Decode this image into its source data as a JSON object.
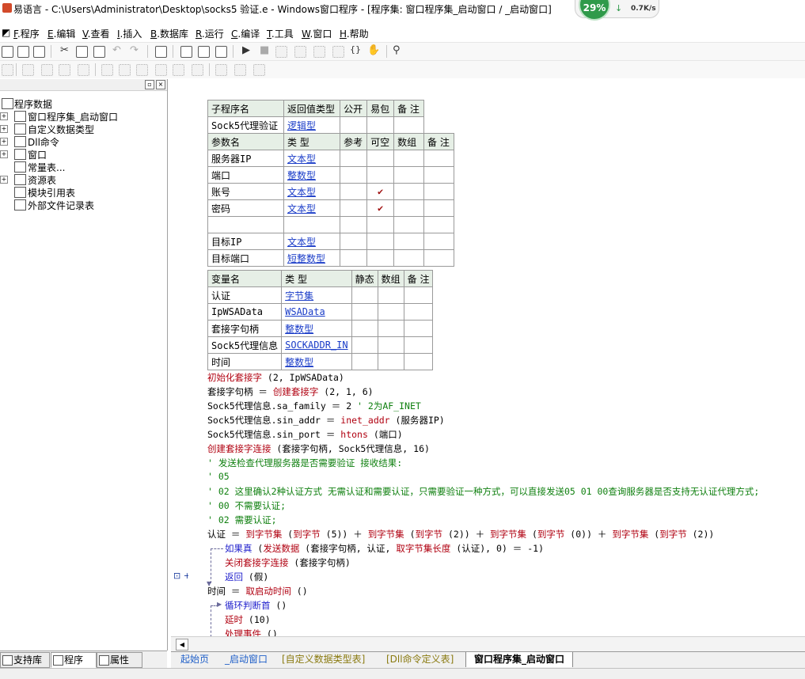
{
  "window": {
    "title": "易语言 - C:\\Users\\Administrator\\Desktop\\socks5 验证.e - Windows窗口程序 - [程序集: 窗口程序集_启动窗口 / _启动窗口]"
  },
  "net_widget": {
    "percent": "29%",
    "arrow": "↓",
    "speed": "0.7K/s"
  },
  "menu": [
    {
      "key": "F",
      "label": ".程序"
    },
    {
      "key": "E",
      "label": ".编辑"
    },
    {
      "key": "V",
      "label": ".查看"
    },
    {
      "key": "I",
      "label": ".插入"
    },
    {
      "key": "B",
      "label": ".数据库"
    },
    {
      "key": "R",
      "label": ".运行"
    },
    {
      "key": "C",
      "label": ".编译"
    },
    {
      "key": "T",
      "label": ".工具"
    },
    {
      "key": "W",
      "label": ".窗口"
    },
    {
      "key": "H",
      "label": ".帮助"
    }
  ],
  "tree": {
    "root": "程序数据",
    "items": [
      {
        "label": "窗口程序集_启动窗口",
        "icon": "module-icon",
        "expand": "+"
      },
      {
        "label": "自定义数据类型",
        "icon": "datatype-icon",
        "expand": "+"
      },
      {
        "label": "Dll命令",
        "icon": "dll-icon",
        "expand": "+"
      },
      {
        "label": "窗口",
        "icon": "window-icon",
        "expand": "+"
      },
      {
        "label": "常量表...",
        "icon": "constant-icon",
        "expand": ""
      },
      {
        "label": "资源表",
        "icon": "resource-icon",
        "expand": "+"
      },
      {
        "label": "模块引用表",
        "icon": "module-ref-icon",
        "expand": ""
      },
      {
        "label": "外部文件记录表",
        "icon": "external-file-icon",
        "expand": ""
      }
    ]
  },
  "panel_tabs": [
    "支持库",
    "程序",
    "属性"
  ],
  "sub_header": {
    "cols": [
      "子程序名",
      "返回值类型",
      "公开",
      "易包",
      "备 注"
    ],
    "name": "Sock5代理验证",
    "return_type": "逻辑型"
  },
  "params": {
    "cols": [
      "参数名",
      "类 型",
      "参考",
      "可空",
      "数组",
      "备 注"
    ],
    "rows": [
      {
        "name": "服务器IP",
        "type": "文本型",
        "nullable": ""
      },
      {
        "name": "端口",
        "type": "整数型",
        "nullable": ""
      },
      {
        "name": "账号",
        "type": "文本型",
        "nullable": "✔"
      },
      {
        "name": "密码",
        "type": "文本型",
        "nullable": "✔"
      },
      {
        "name": "",
        "type": "",
        "nullable": ""
      },
      {
        "name": "目标IP",
        "type": "文本型",
        "nullable": ""
      },
      {
        "name": "目标端口",
        "type": "短整数型",
        "nullable": ""
      }
    ]
  },
  "locals": {
    "cols": [
      "变量名",
      "类 型",
      "静态",
      "数组",
      "备 注"
    ],
    "rows": [
      {
        "name": "认证",
        "type": "字节集"
      },
      {
        "name": "IpWSAData",
        "type": "WSAData"
      },
      {
        "name": "套接字句柄",
        "type": "整数型"
      },
      {
        "name": "Sock5代理信息",
        "type": "SOCKADDR_IN"
      },
      {
        "name": "时间",
        "type": "整数型"
      }
    ]
  },
  "code": {
    "l1": {
      "fn": "初始化套接字",
      "rest": " (2, IpWSAData)"
    },
    "l2": {
      "a": "套接字句柄 ＝ ",
      "fn": "创建套接字",
      "rest": " (2, 1, 6)"
    },
    "l3": {
      "a": "Sock5代理信息.sa_family ＝ 2  ",
      "cm": "' 2为AF_INET"
    },
    "l4": {
      "a": "Sock5代理信息.sin_addr ＝ ",
      "fn": "inet_addr",
      "rest": " (服务器IP)"
    },
    "l5": {
      "a": "Sock5代理信息.sin_port ＝ ",
      "fn": "htons",
      "rest": " (端口)"
    },
    "l6": {
      "fn": "创建套接字连接",
      "rest": " (套接字句柄, Sock5代理信息, 16)"
    },
    "l7": "' 发送检查代理服务器是否需要验证 接收结果:",
    "l8": "' 05",
    "l9": "' 02 这里确认2种认证方式 无需认证和需要认证，只需要验证一种方式，可以直接发送05 01 00查询服务器是否支持无认证代理方式;",
    "l10": "' 00 不需要认证;",
    "l11": "' 02 需要认证;",
    "l12": {
      "a": "认证 ＝ ",
      "p1": "到字节集",
      "p2": " (",
      "p3": "到字节",
      "p4": " (5)) ＋ ",
      "p5": "到字节集",
      "p6": " (",
      "p7": "到字节",
      "p8": " (2)) ＋ ",
      "p9": "到字节集",
      "p10": " (",
      "p11": "到字节",
      "p12": " (0)) ＋ ",
      "p13": "到字节集",
      "p14": " (",
      "p15": "到字节",
      "p16": " (2))"
    },
    "l13": {
      "ctl": "如果真",
      "a": " (",
      "fn": "发送数据",
      "b": " (套接字句柄, 认证, ",
      "fn2": "取字节集长度",
      "c": " (认证), 0) ＝ -1)"
    },
    "l14": {
      "fn": "关闭套接字连接",
      "rest": " (套接字句柄)"
    },
    "l15": {
      "ctl": "返回",
      "rest": " (假)"
    },
    "l16": {
      "a": "时间 ＝ ",
      "fn": "取启动时间",
      "rest": " ()"
    },
    "l17": {
      "ctl": "循环判断首",
      "rest": " ()"
    },
    "l18": {
      "fn": "延时",
      "rest": " (10)"
    },
    "l19": {
      "fn": "处理事件",
      "rest": " ()"
    }
  },
  "doc_tabs": [
    "起始页",
    "_启动窗口",
    "[自定义数据类型表]",
    "[Dll命令定义表]",
    "窗口程序集_启动窗口"
  ],
  "colors": {
    "type_link": "#1a3cc8",
    "keyword": "#b00010",
    "comment": "#108010",
    "flow": "#1f1fcc"
  }
}
